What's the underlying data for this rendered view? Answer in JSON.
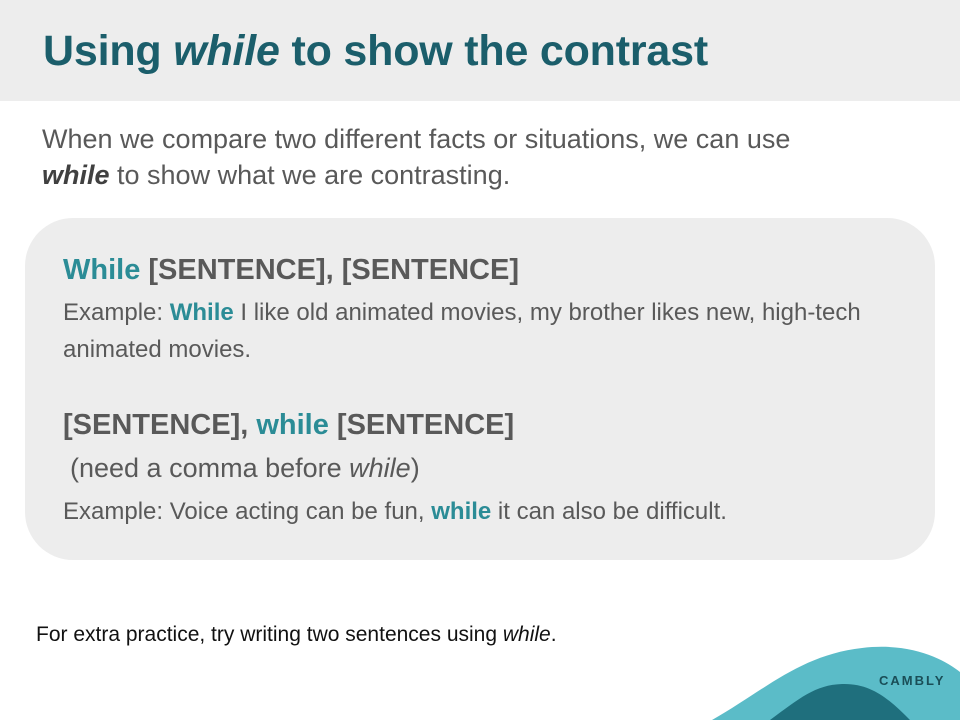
{
  "slide": {
    "title_pre": "Using ",
    "title_em": "while",
    "title_post": " to show the contrast",
    "intro_line1": "When we compare two different facts or situations, we can use",
    "intro_kw": "while",
    "intro_line2_rest": " to show what we are contrasting.",
    "pattern1": {
      "kw": "While",
      "rest": " [SENTENCE], [SENTENCE]",
      "example_pre": "Example: ",
      "example_kw": "While",
      "example_post": " I like old animated movies, my brother likes new, high-tech animated movies."
    },
    "pattern2": {
      "pre": "[SENTENCE], ",
      "kw": "while",
      "post": " [SENTENCE]",
      "note_pre": "(need a comma before ",
      "note_kw": "while",
      "note_post": ")",
      "example_pre": "Example: Voice acting can be fun, ",
      "example_kw": "while",
      "example_post": " it can also be difficult."
    },
    "practice_pre": "For extra practice, try writing two sentences using ",
    "practice_kw": "while",
    "practice_post": ".",
    "brand": "CAMBLY"
  },
  "colors": {
    "title": "#1b5e6b",
    "accent": "#2b8c96",
    "body_text": "#595959",
    "panel_bg": "#ededed",
    "wave_light": "#5bbcc8",
    "wave_dark": "#1f6f7d"
  }
}
